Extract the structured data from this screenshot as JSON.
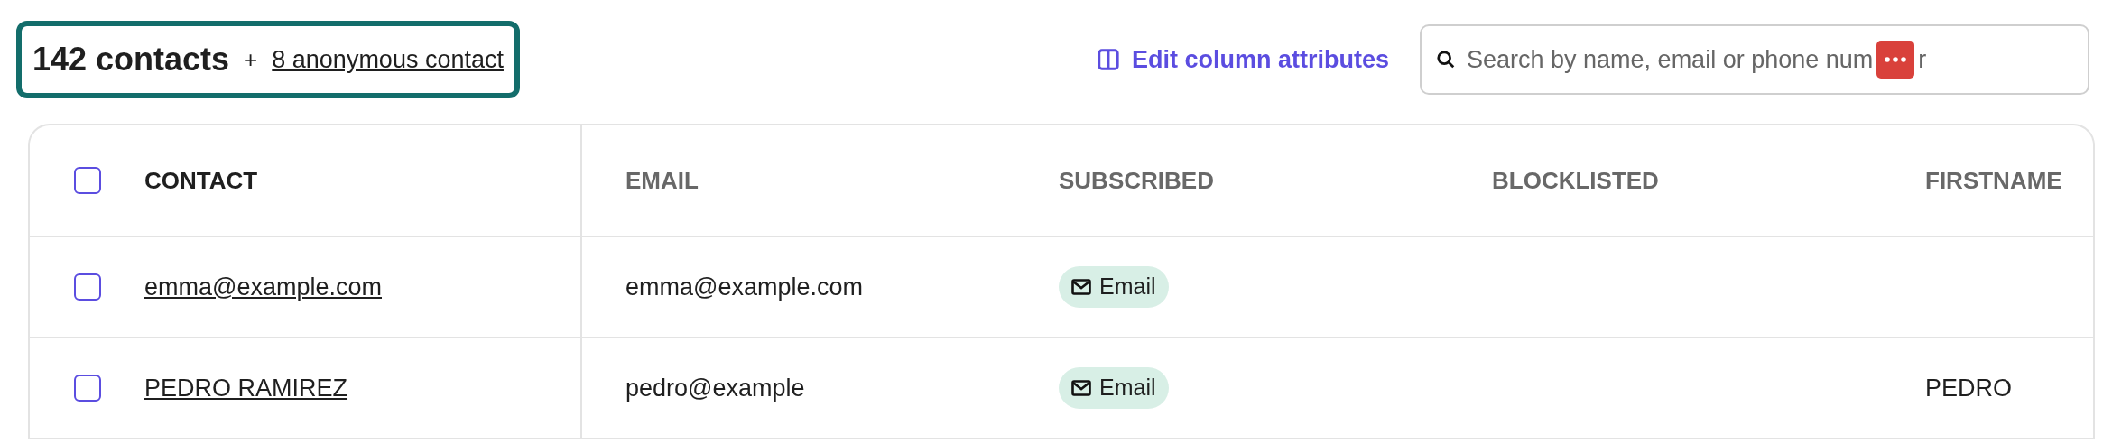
{
  "summary": {
    "count": "142 contacts",
    "plus": "+",
    "anonymous_link": "8 anonymous contact"
  },
  "edit_columns": {
    "label": "Edit column attributes"
  },
  "search": {
    "placeholder": "Search by name, email or phone num",
    "placeholder_tail": "r"
  },
  "table": {
    "columns": [
      {
        "label": "CONTACT",
        "kind": "contact"
      },
      {
        "label": "EMAIL",
        "kind": "text"
      },
      {
        "label": "SUBSCRIBED",
        "kind": "tags"
      },
      {
        "label": "BLOCKLISTED",
        "kind": "text"
      },
      {
        "label": "FIRSTNAME",
        "kind": "text"
      }
    ],
    "select_all": {
      "checked": false
    },
    "rows": [
      {
        "checked": false,
        "cells": [
          "emma@example.com",
          "emma@example.com",
          [
            "Email"
          ],
          "",
          ""
        ]
      },
      {
        "checked": false,
        "cells": [
          "PEDRO RAMIREZ",
          "pedro@example",
          [
            "Email"
          ],
          "",
          "PEDRO"
        ]
      }
    ]
  }
}
